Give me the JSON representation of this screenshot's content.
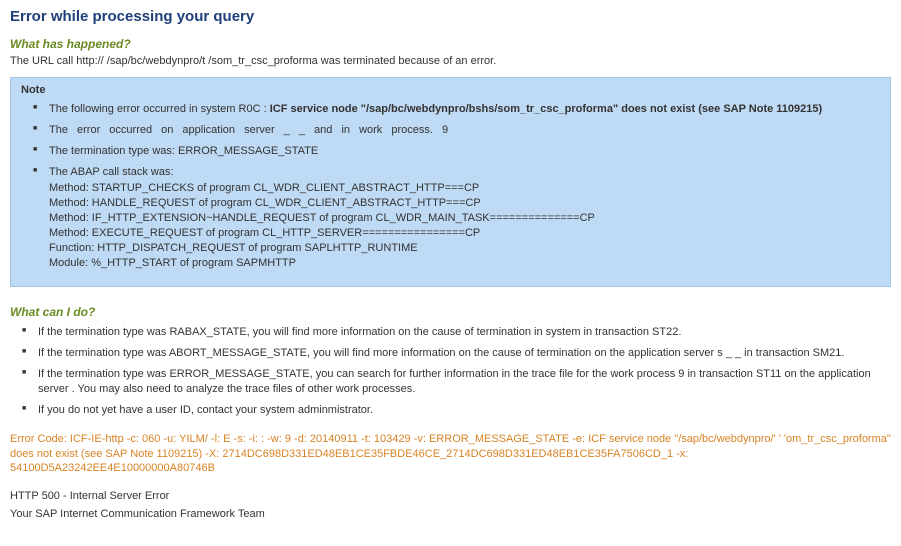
{
  "title": "Error while processing your query",
  "section_happened": "What has happened?",
  "intro": "The URL call http://                         /sap/bc/webdynpro/t      /som_tr_csc_proforma was terminated because of an error.",
  "note_label": "Note",
  "note_items": {
    "i0_prefix": "The following error occurred in system R0C : ",
    "i0_bold": "ICF service node \"/sap/bc/webdynpro/bshs/som_tr_csc_proforma\" does not exist (see SAP Note 1109215)",
    "i1": "The error occurred on application server              _     _          and in work process. 9",
    "i2": "The termination type was: ERROR_MESSAGE_STATE",
    "i3_head": "The ABAP call stack was:",
    "i3_lines": [
      "Method: STARTUP_CHECKS of program CL_WDR_CLIENT_ABSTRACT_HTTP===CP",
      "Method: HANDLE_REQUEST of program CL_WDR_CLIENT_ABSTRACT_HTTP===CP",
      "Method: IF_HTTP_EXTENSION~HANDLE_REQUEST of program CL_WDR_MAIN_TASK==============CP",
      "Method: EXECUTE_REQUEST of program CL_HTTP_SERVER================CP",
      "Function: HTTP_DISPATCH_REQUEST of program SAPLHTTP_RUNTIME",
      "Module: %_HTTP_START of program SAPMHTTP"
    ]
  },
  "section_todo": "What can I do?",
  "todo_items": [
    "If the termination type was RABAX_STATE, you will find more information on the cause of termination in system          in transaction ST22.",
    "If the termination type was ABORT_MESSAGE_STATE, you will find more information on the cause of termination on the application server s            _     _         in transaction SM21.",
    "If the termination type was ERROR_MESSAGE_STATE, you can search for further information in the trace file for the work process 9 in transaction ST11 on the application server                 . You may also need to analyze the trace files of other work processes.",
    "If you do not yet have a user ID, contact your system adminmistrator."
  ],
  "error_code": "Error Code: ICF-IE-http -c: 060 -u: YILM/        -l: E -s:            -i: :                           -w: 9 -d: 20140911 -t: 103429 -v: ERROR_MESSAGE_STATE -e: ICF service node \"/sap/bc/webdynpro/'  '  'om_tr_csc_proforma\" does not exist (see SAP Note 1109215) -X: 2714DC698D331ED48EB1CE35FBDE46CE_2714DC698D331ED48EB1CE35FA7506CD_1 -x: 54100D5A23242EE4E10000000A80746B",
  "http_status": "HTTP 500 - Internal Server Error",
  "team": "Your SAP Internet Communication Framework Team"
}
